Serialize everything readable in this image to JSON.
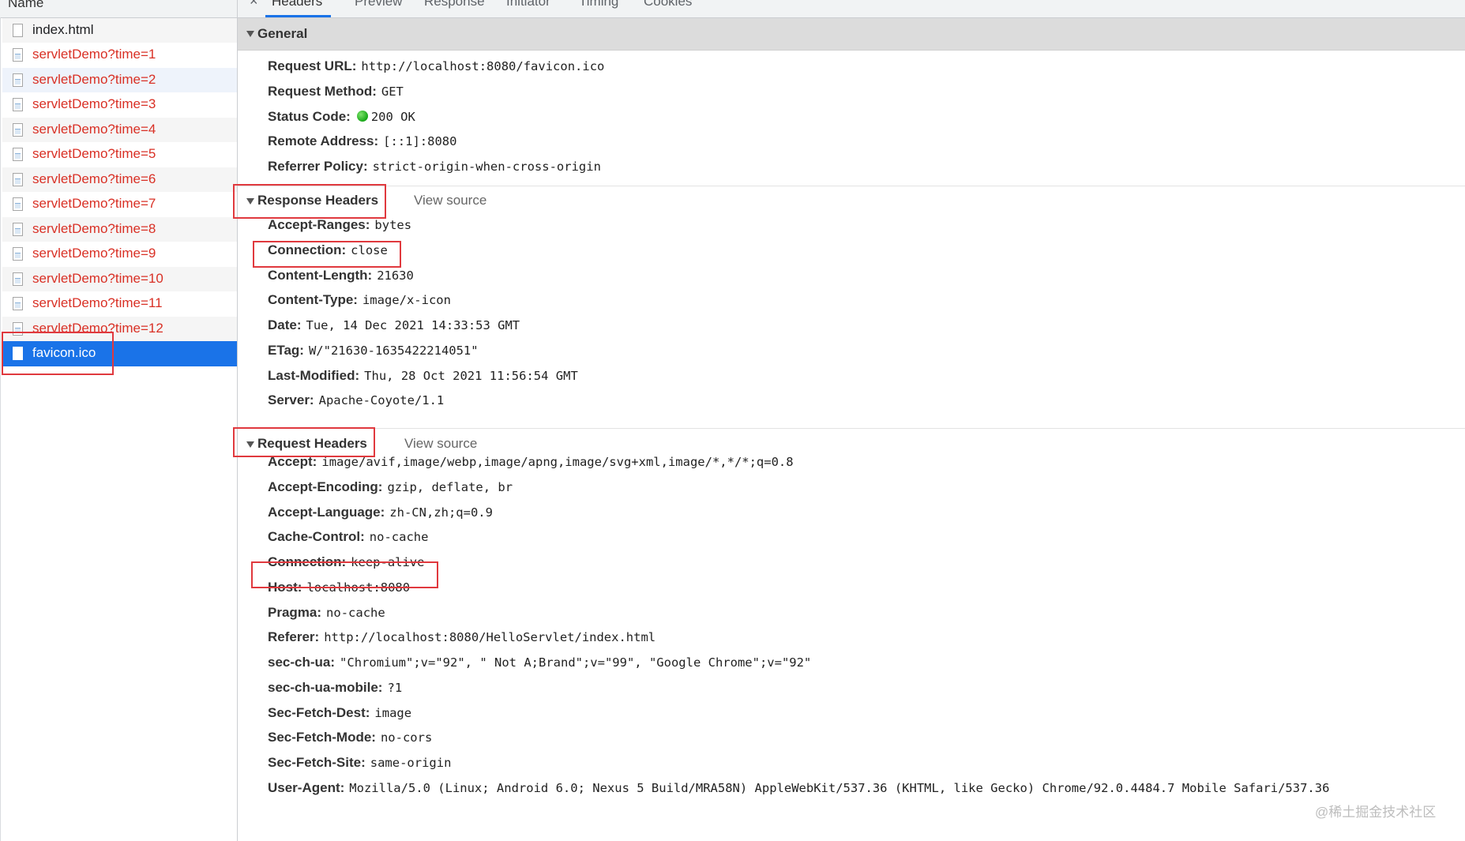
{
  "network_list": {
    "column_header": "Name",
    "requests": [
      {
        "name": "index.html",
        "status": "ok",
        "icon": "document-icon"
      },
      {
        "name": "servletDemo?time=1",
        "status": "error",
        "icon": "image-file-icon"
      },
      {
        "name": "servletDemo?time=2",
        "status": "error",
        "icon": "image-file-icon"
      },
      {
        "name": "servletDemo?time=3",
        "status": "error",
        "icon": "image-file-icon"
      },
      {
        "name": "servletDemo?time=4",
        "status": "error",
        "icon": "image-file-icon"
      },
      {
        "name": "servletDemo?time=5",
        "status": "error",
        "icon": "image-file-icon"
      },
      {
        "name": "servletDemo?time=6",
        "status": "error",
        "icon": "image-file-icon"
      },
      {
        "name": "servletDemo?time=7",
        "status": "error",
        "icon": "image-file-icon"
      },
      {
        "name": "servletDemo?time=8",
        "status": "error",
        "icon": "image-file-icon"
      },
      {
        "name": "servletDemo?time=9",
        "status": "error",
        "icon": "image-file-icon"
      },
      {
        "name": "servletDemo?time=10",
        "status": "error",
        "icon": "image-file-icon"
      },
      {
        "name": "servletDemo?time=11",
        "status": "error",
        "icon": "image-file-icon"
      },
      {
        "name": "servletDemo?time=12",
        "status": "error",
        "icon": "image-file-icon"
      },
      {
        "name": "favicon.ico",
        "status": "selected",
        "icon": "document-icon"
      }
    ]
  },
  "tabs": {
    "close_icon": "close-icon",
    "items": [
      "Headers",
      "Preview",
      "Response",
      "Initiator",
      "Timing",
      "Cookies"
    ],
    "active": "Headers"
  },
  "general": {
    "title": "General",
    "rows": [
      {
        "key": "Request URL:",
        "value": "http://localhost:8080/favicon.ico"
      },
      {
        "key": "Request Method:",
        "value": "GET"
      },
      {
        "key": "Status Code:",
        "value": "200 OK",
        "indicator": "green-status-dot"
      },
      {
        "key": "Remote Address:",
        "value": "[::1]:8080"
      },
      {
        "key": "Referrer Policy:",
        "value": "strict-origin-when-cross-origin"
      }
    ]
  },
  "response_headers": {
    "title": "Response Headers",
    "view_source": "View source",
    "rows": [
      {
        "key": "Accept-Ranges:",
        "value": "bytes"
      },
      {
        "key": "Connection:",
        "value": "close"
      },
      {
        "key": "Content-Length:",
        "value": "21630"
      },
      {
        "key": "Content-Type:",
        "value": "image/x-icon"
      },
      {
        "key": "Date:",
        "value": "Tue, 14 Dec 2021 14:33:53 GMT"
      },
      {
        "key": "ETag:",
        "value": "W/\"21630-1635422214051\""
      },
      {
        "key": "Last-Modified:",
        "value": "Thu, 28 Oct 2021 11:56:54 GMT"
      },
      {
        "key": "Server:",
        "value": "Apache-Coyote/1.1"
      }
    ]
  },
  "request_headers": {
    "title": "Request Headers",
    "view_source": "View source",
    "rows": [
      {
        "key": "Accept:",
        "value": "image/avif,image/webp,image/apng,image/svg+xml,image/*,*/*;q=0.8"
      },
      {
        "key": "Accept-Encoding:",
        "value": "gzip, deflate, br"
      },
      {
        "key": "Accept-Language:",
        "value": "zh-CN,zh;q=0.9"
      },
      {
        "key": "Cache-Control:",
        "value": "no-cache"
      },
      {
        "key": "Connection:",
        "value": "keep-alive"
      },
      {
        "key": "Host:",
        "value": "localhost:8080"
      },
      {
        "key": "Pragma:",
        "value": "no-cache"
      },
      {
        "key": "Referer:",
        "value": "http://localhost:8080/HelloServlet/index.html"
      },
      {
        "key": "sec-ch-ua:",
        "value": "\"Chromium\";v=\"92\", \" Not A;Brand\";v=\"99\", \"Google Chrome\";v=\"92\""
      },
      {
        "key": "sec-ch-ua-mobile:",
        "value": "?1"
      },
      {
        "key": "Sec-Fetch-Dest:",
        "value": "image"
      },
      {
        "key": "Sec-Fetch-Mode:",
        "value": "no-cors"
      },
      {
        "key": "Sec-Fetch-Site:",
        "value": "same-origin"
      },
      {
        "key": "User-Agent:",
        "value": "Mozilla/5.0 (Linux; Android 6.0; Nexus 5 Build/MRA58N) AppleWebKit/537.36 (KHTML, like Gecko) Chrome/92.0.4484.7 Mobile Safari/537.36"
      }
    ]
  },
  "watermark": "@稀土掘金技术社区",
  "colors": {
    "error_text": "#d93025",
    "selection": "#1a73e8",
    "annotation_box": "#e0393e",
    "status_ok": "#18a818"
  }
}
